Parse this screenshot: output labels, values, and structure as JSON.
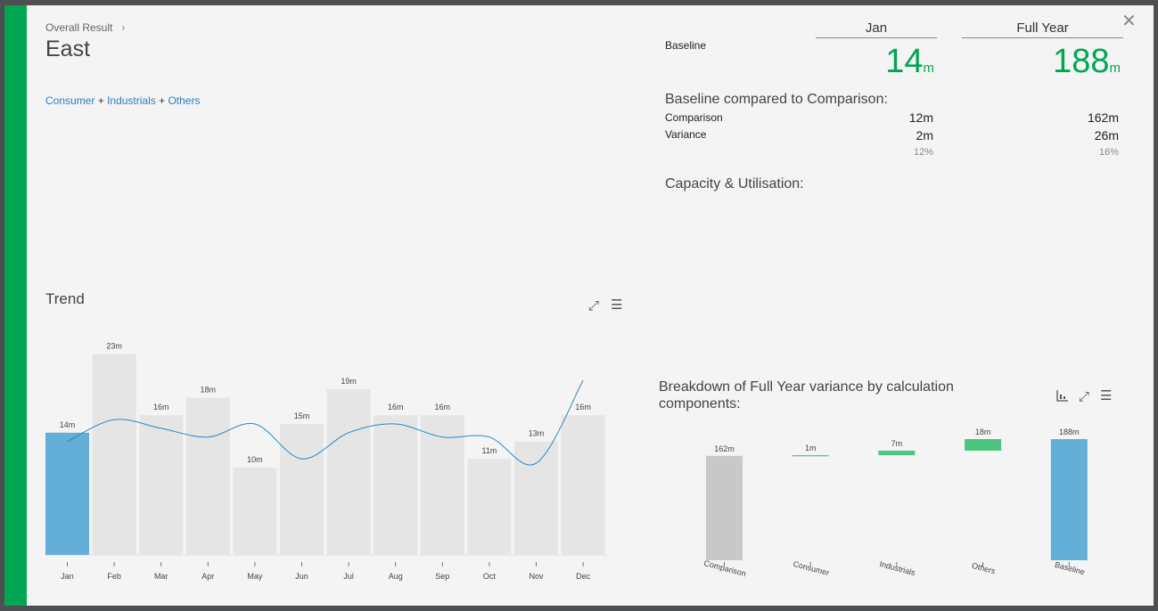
{
  "header": {
    "breadcrumb": "Overall Result",
    "region": "East",
    "filter": {
      "item1": "Consumer",
      "item2": "Industrials",
      "item3": "Others",
      "sep": "+"
    }
  },
  "icons": {
    "close": "close-icon",
    "expand": "expand-icon",
    "menu": "menu-icon",
    "chart_type": "chart-type-icon"
  },
  "colors": {
    "accent": "#00a651",
    "highlight_bar": "#64afd8",
    "bar": "#e4e5e4",
    "trend_line": "#2e86c1",
    "positive": "#4ec57f",
    "comparison": "#c8c8c8"
  },
  "summary": {
    "col_jan": "Jan",
    "col_full_year": "Full Year",
    "baseline_label": "Baseline",
    "baseline_jan": "14",
    "baseline_fy": "188",
    "unit": "m",
    "compare_title": "Baseline compared to Comparison:",
    "comparison_label": "Comparison",
    "comparison_jan": "12m",
    "comparison_fy": "162m",
    "variance_label": "Variance",
    "variance_jan": "2m",
    "variance_fy": "26m",
    "variance_pct_jan": "12%",
    "variance_pct_fy": "16%",
    "capacity_title": "Capacity & Utilisation:"
  },
  "trend": {
    "title": "Trend"
  },
  "breakdown": {
    "title": "Breakdown of Full Year variance by calculation components:"
  },
  "chart_data": [
    {
      "type": "bar",
      "title": "Trend",
      "categories": [
        "Jan",
        "Feb",
        "Mar",
        "Apr",
        "May",
        "Jun",
        "Jul",
        "Aug",
        "Sep",
        "Oct",
        "Nov",
        "Dec"
      ],
      "values": [
        14,
        23,
        16,
        18,
        10,
        15,
        19,
        16,
        16,
        11,
        13,
        16
      ],
      "labels": [
        "14m",
        "23m",
        "16m",
        "18m",
        "10m",
        "15m",
        "19m",
        "16m",
        "16m",
        "11m",
        "13m",
        "16m"
      ],
      "highlight_index": 0,
      "line_values": [
        13,
        15.5,
        14.5,
        13.5,
        15,
        11,
        14,
        15,
        13.5,
        13.5,
        10.5,
        20
      ],
      "ylim": [
        0,
        25
      ]
    },
    {
      "type": "waterfall",
      "title": "Breakdown of Full Year variance by calculation components:",
      "categories": [
        "Comparison",
        "Consumer",
        "Industrials",
        "Others",
        "Baseline"
      ],
      "values": [
        162,
        1,
        7,
        18,
        188
      ],
      "labels": [
        "162m",
        "1m",
        "7m",
        "18m",
        "188m"
      ],
      "kinds": [
        "total",
        "delta",
        "delta",
        "delta",
        "total"
      ],
      "ylim": [
        0,
        200
      ]
    }
  ]
}
